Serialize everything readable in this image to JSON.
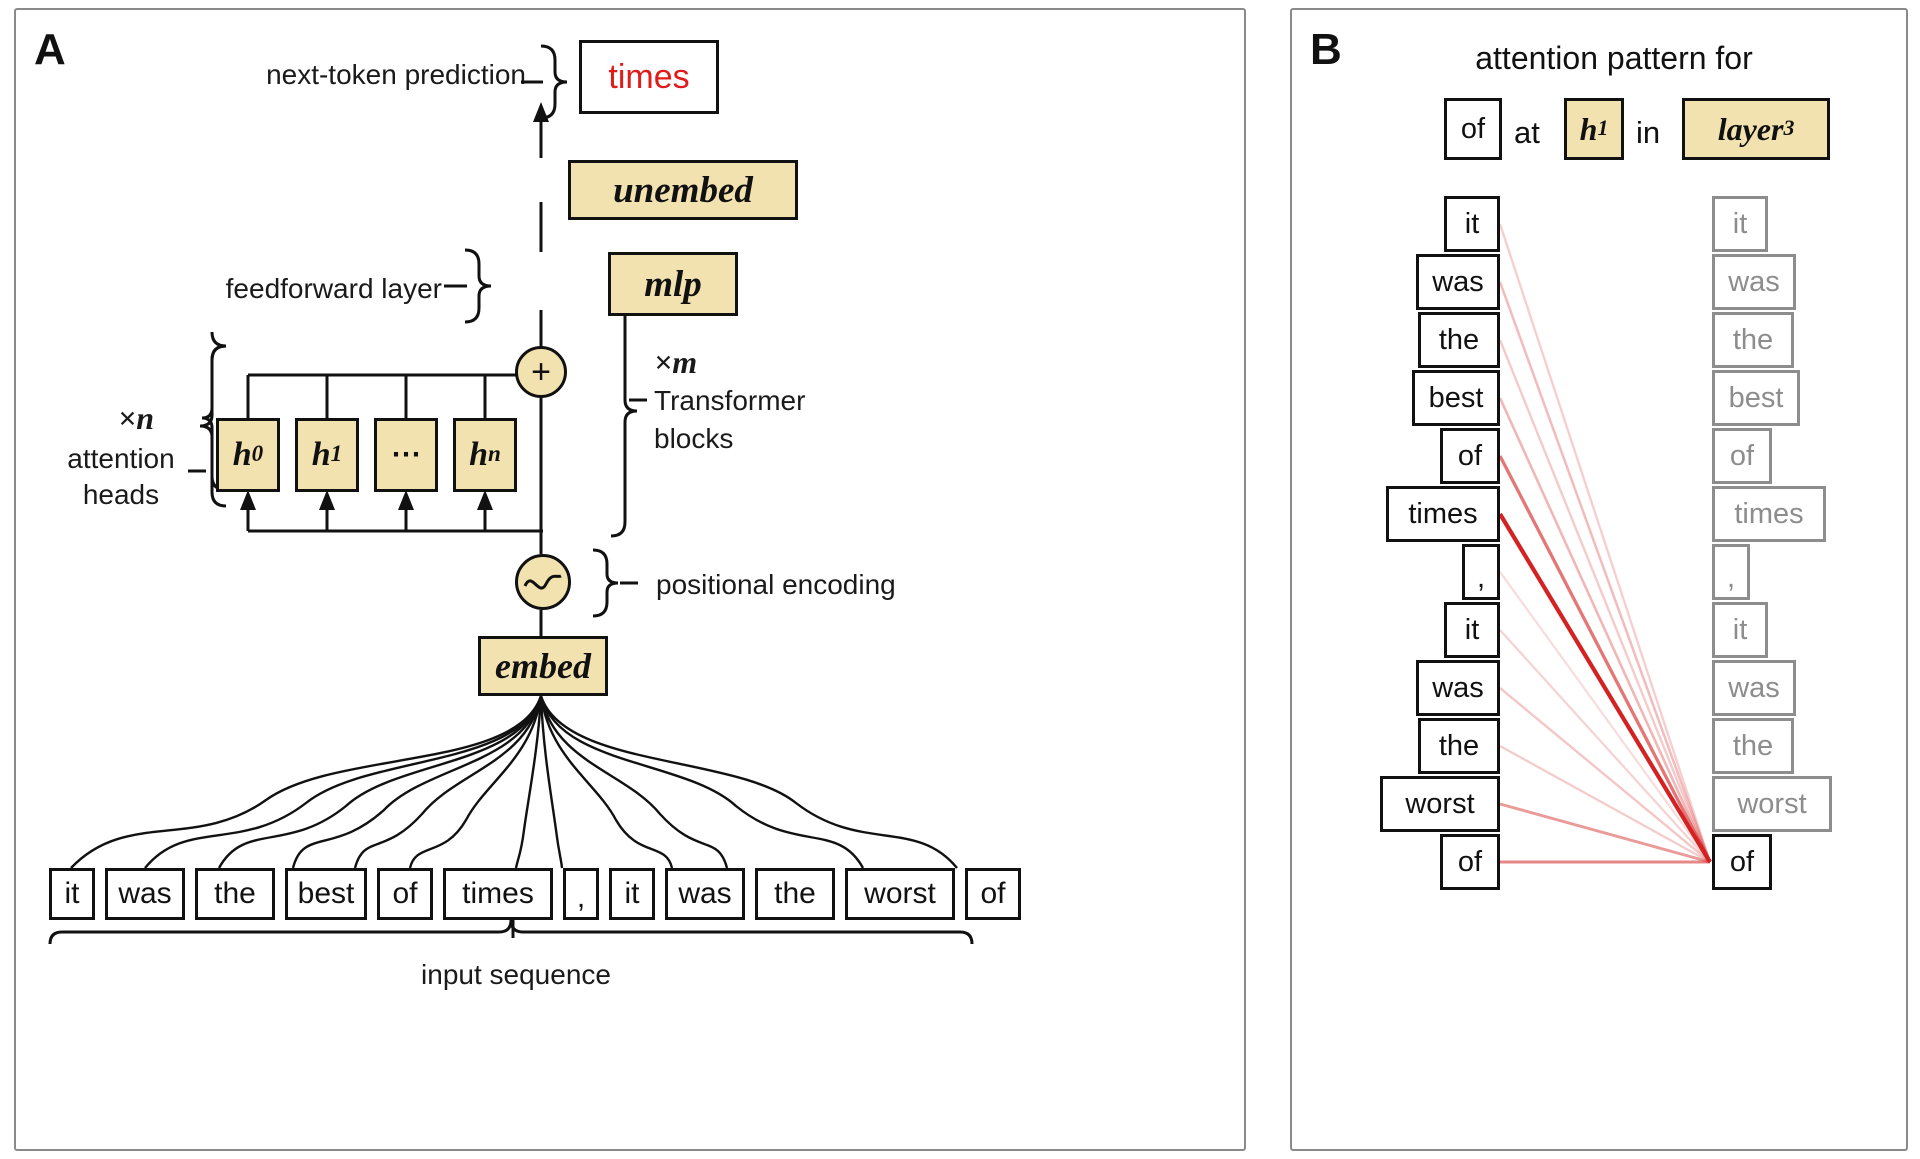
{
  "colors": {
    "yellow_fill": "#f2e2b0",
    "stroke": "#111111",
    "ghost": "#8d8d8d",
    "highlight_red": "#e01b1b",
    "panel_border": "#8a8a8a",
    "attention_line": "#d42222"
  },
  "panel_a": {
    "letter": "A",
    "labels": {
      "next_token_prediction": "next-token prediction",
      "feedforward_layer": "feedforward layer",
      "positional_encoding": "positional encoding",
      "input_sequence": "input sequence",
      "attention_heads_multiplier": "×n",
      "attention_heads_line1": "attention",
      "attention_heads_line2": "heads",
      "transformer_blocks_multiplier": "×m",
      "transformer_blocks_line1": "Transformer",
      "transformer_blocks_line2": "blocks"
    },
    "prediction_token": "times",
    "blocks": {
      "unembed": "unembed",
      "mlp": "mlp",
      "embed": "embed",
      "residual_add": "+",
      "positional_encoding_icon": "sine-wave-icon"
    },
    "heads": [
      {
        "base": "h",
        "sub": "0"
      },
      {
        "base": "h",
        "sub": "1"
      },
      {
        "base": "⋯",
        "sub": ""
      },
      {
        "base": "h",
        "sub": "n"
      }
    ],
    "input_tokens": [
      "it",
      "was",
      "the",
      "best",
      "of",
      "times",
      ",",
      "it",
      "was",
      "the",
      "worst",
      "of"
    ]
  },
  "panel_b": {
    "letter": "B",
    "title": "attention pattern for",
    "query_token": "of",
    "word_at": "at",
    "head": {
      "base": "h",
      "sub": "1"
    },
    "word_in": "in",
    "layer": {
      "base": "layer",
      "sub": "3"
    },
    "source_tokens": [
      "it",
      "was",
      "the",
      "best",
      "of",
      "times",
      ",",
      "it",
      "was",
      "the",
      "worst",
      "of"
    ],
    "target_tokens": [
      "it",
      "was",
      "the",
      "best",
      "of",
      "times",
      ",",
      "it",
      "was",
      "the",
      "worst",
      "of"
    ],
    "attention_weights": [
      0.22,
      0.3,
      0.24,
      0.33,
      0.62,
      1.0,
      0.16,
      0.2,
      0.26,
      0.23,
      0.46,
      0.55
    ]
  }
}
